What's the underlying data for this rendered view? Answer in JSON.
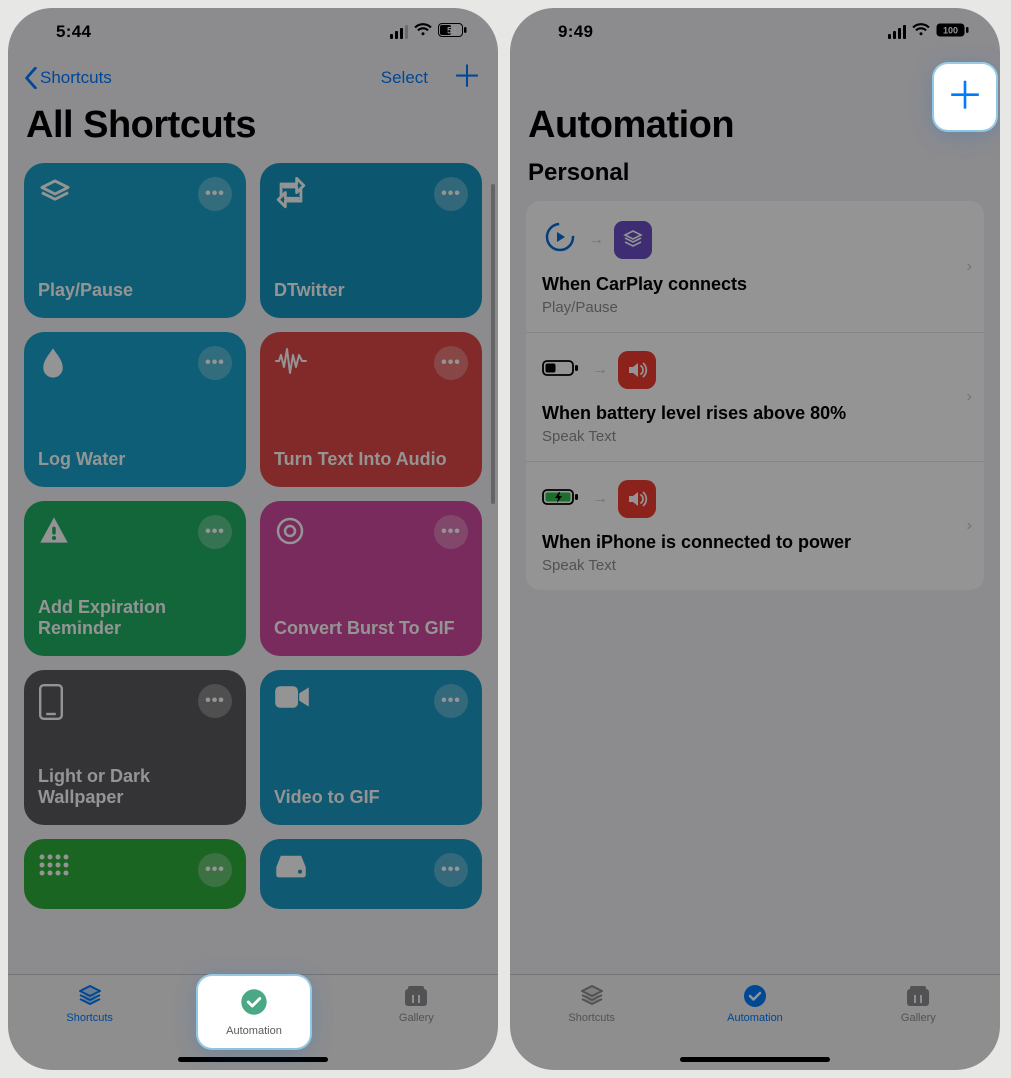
{
  "left": {
    "status": {
      "time": "5:44",
      "battery_label": "51"
    },
    "nav": {
      "back_label": "Shortcuts",
      "select_label": "Select"
    },
    "title": "All Shortcuts",
    "cards": [
      {
        "label": "Play/Pause",
        "color": "#1aa0c9",
        "icon": "layers"
      },
      {
        "label": "DTwitter",
        "color": "#1696bf",
        "icon": "retweet"
      },
      {
        "label": "Log Water",
        "color": "#17a3cc",
        "icon": "drop"
      },
      {
        "label": "Turn Text Into Audio",
        "color": "#e04848",
        "icon": "wave"
      },
      {
        "label": "Add Expiration Reminder",
        "color": "#1fb063",
        "icon": "warning"
      },
      {
        "label": "Convert Burst To GIF",
        "color": "#d34aa0",
        "icon": "target"
      },
      {
        "label": "Light or Dark Wallpaper",
        "color": "#5b5b5e",
        "icon": "phone"
      },
      {
        "label": "Video to GIF",
        "color": "#1a9ac4",
        "icon": "video"
      }
    ],
    "row5": [
      {
        "color": "#2fae3b",
        "icon": "grid"
      },
      {
        "color": "#1a9ac4",
        "icon": "disk"
      }
    ],
    "tabs": {
      "shortcuts": "Shortcuts",
      "automation": "Automation",
      "gallery": "Gallery"
    },
    "highlight_tab": "automation"
  },
  "right": {
    "status": {
      "time": "9:49",
      "battery_label": "100"
    },
    "title": "Automation",
    "section": "Personal",
    "items": [
      {
        "title": "When CarPlay connects",
        "sub": "Play/Pause"
      },
      {
        "title": "When battery level rises above 80%",
        "sub": "Speak Text"
      },
      {
        "title": "When iPhone is connected to power",
        "sub": "Speak Text"
      }
    ],
    "tabs": {
      "shortcuts": "Shortcuts",
      "automation": "Automation",
      "gallery": "Gallery"
    },
    "highlight": "plus"
  }
}
